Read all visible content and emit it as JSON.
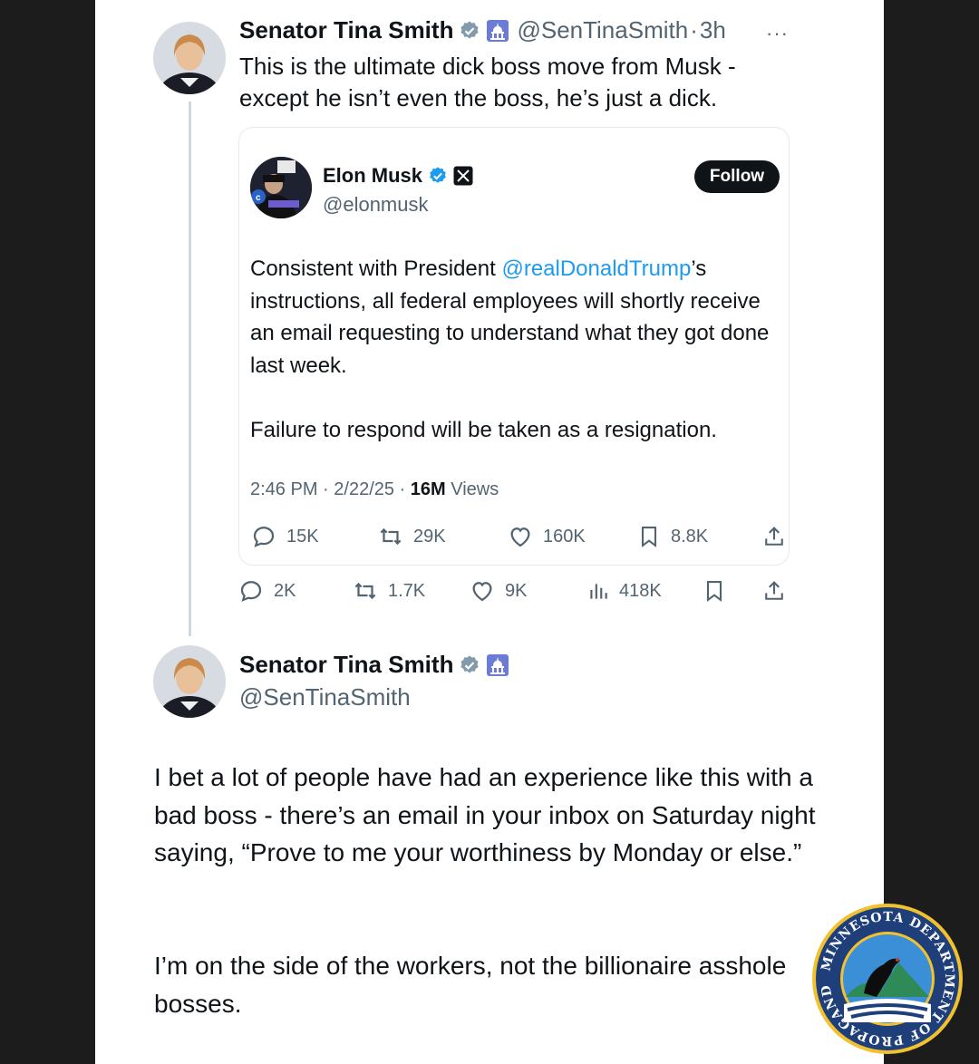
{
  "main_tweet": {
    "author_name": "Senator Tina Smith",
    "handle": "@SenTinaSmith",
    "separator": "·",
    "time": "3h",
    "more": "···",
    "text": "This is the ultimate dick boss move from Musk - except he isn't even the boss, he's just a dick.",
    "text_line1": "This is the ultimate dick boss move from Musk -",
    "text_line2": "except he isn’t even the boss, he’s just a dick.",
    "metrics": {
      "replies": "2K",
      "reposts": "1.7K",
      "likes": "9K",
      "views": "418K"
    }
  },
  "quoted_tweet": {
    "author_name": "Elon Musk",
    "handle": "@elonmusk",
    "follow_label": "Follow",
    "text_before_mention": "Consistent with President ",
    "mention": "@realDonaldTrump",
    "text_after_mention": "’s instructions, all federal employees will shortly receive an email requesting to understand what they got done last week.",
    "text_2": "Failure to respond will be taken as a resignation.",
    "time": "2:46 PM",
    "date": "2/22/25",
    "views_count": "16M",
    "views_label": "Views",
    "metrics": {
      "replies": "15K",
      "reposts": "29K",
      "likes": "160K",
      "bookmarks": "8.8K"
    }
  },
  "reply_tweet": {
    "author_name": "Senator Tina Smith",
    "handle": "@SenTinaSmith",
    "paragraph_1": "I bet a lot of people have had an experience like this with a bad boss - there’s an email in your inbox on Saturday night saying, “Prove to me your worthiness by Monday or else.”",
    "paragraph_2": "I’m on the side of the workers, not the billionaire asshole bosses."
  },
  "seal": {
    "ring_text_top": "MINNESOTA DEPARTMENT OF PROPAGANDA",
    "colors": {
      "ring": "#1f3f7a",
      "gold": "#f2c12e",
      "sky": "#3a8fd6"
    }
  },
  "colors": {
    "link": "#1d9bf0",
    "verified": "#1d9bf0",
    "secondary_text": "#536471",
    "text": "#0f1419"
  }
}
